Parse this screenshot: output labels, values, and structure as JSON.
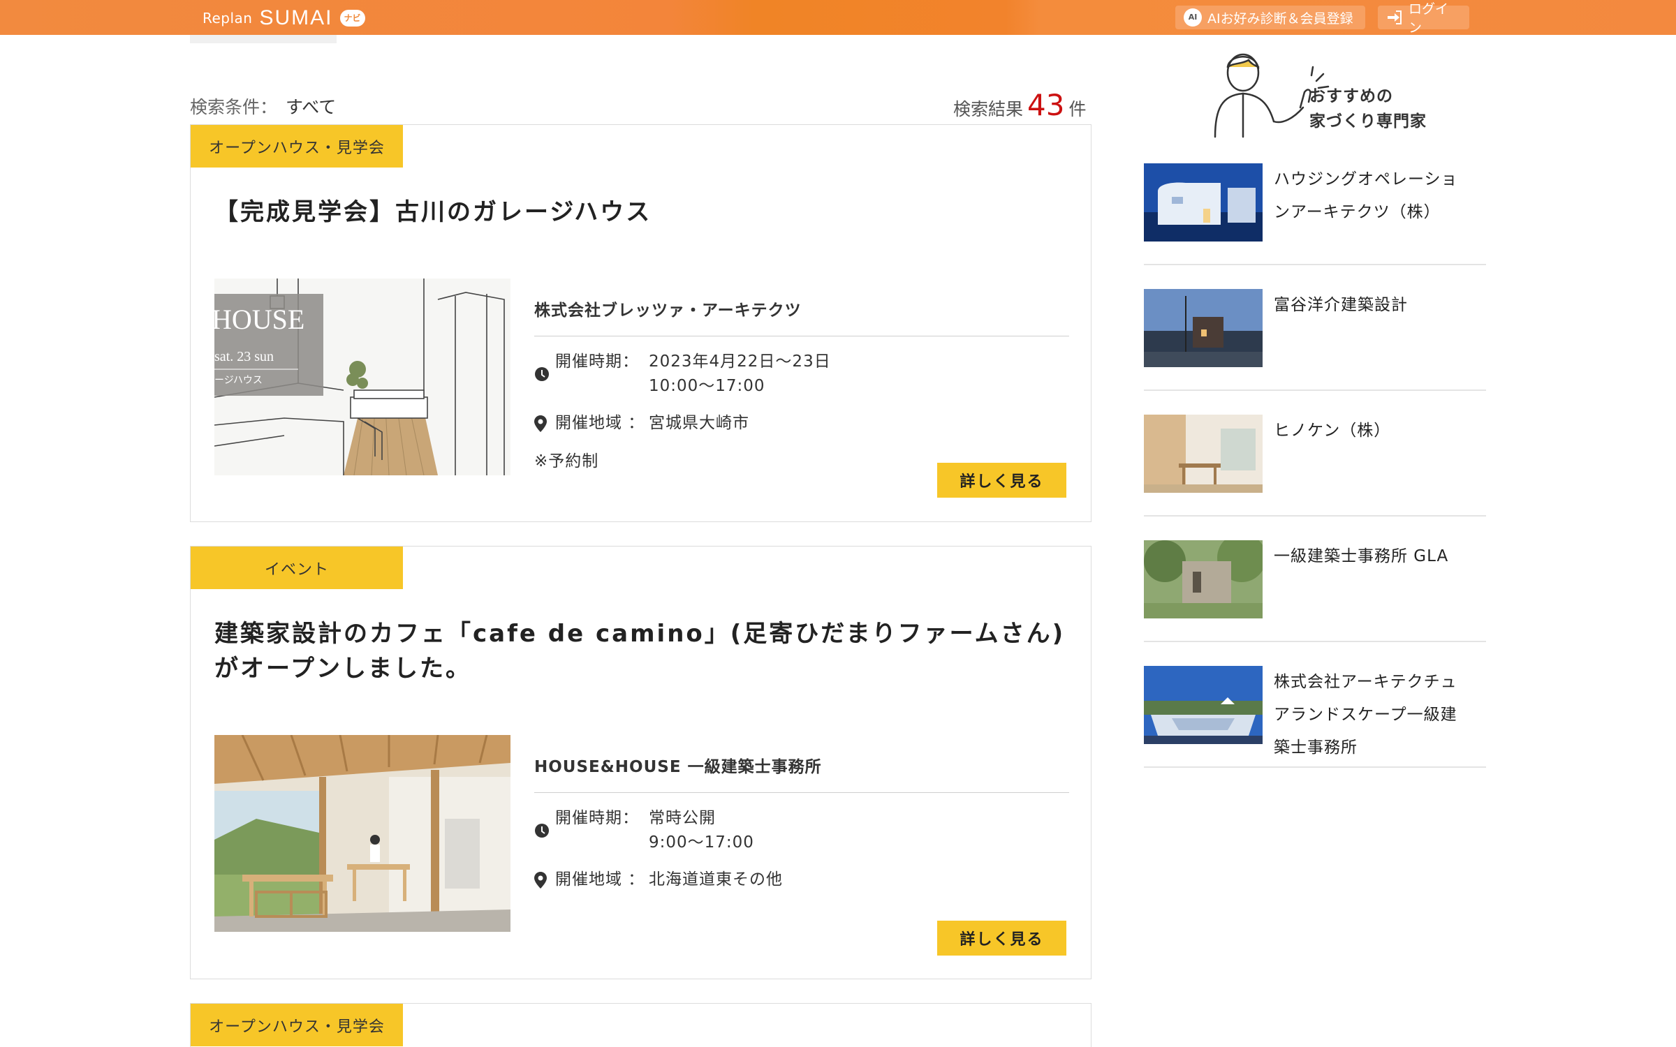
{
  "header": {
    "logo_replan": "Replan",
    "logo_sumai": "SUMAI",
    "logo_navi": "ナビ",
    "ai_button_label": "AIお好み診断＆会員登録",
    "login_label": "ログイン"
  },
  "search": {
    "condition_label": "検索条件：",
    "condition_value": "すべて",
    "result_label": "検索結果",
    "result_count": "43",
    "result_unit": "件"
  },
  "events": [
    {
      "category": "オープンハウス・見学会",
      "title": "【完成見学会】古川のガレージハウス",
      "image_text_big": "HOUSE",
      "image_text_date": "sat. 23 sun",
      "image_text_sub": "ージハウス",
      "company": "株式会社ブレッツァ・アーキテクツ",
      "period_label": "開催時期：",
      "period_date": "2023年4月22日～23日",
      "period_time": "10:00～17:00",
      "area_label": "開催地域 ：",
      "area_value": "宮城県大崎市",
      "note": "※予約制",
      "more_label": "詳しく見る"
    },
    {
      "category": "イベント",
      "title": "建築家設計のカフェ「cafe de camino」(足寄ひだまりファームさん)がオープンしました。",
      "company": "HOUSE&HOUSE 一級建築士事務所",
      "period_label": "開催時期：",
      "period_date": "常時公開",
      "period_time": "9:00～17:00",
      "area_label": "開催地域 ：",
      "area_value": "北海道道東その他",
      "more_label": "詳しく見る"
    },
    {
      "category": "オープンハウス・見学会"
    }
  ],
  "sidebar": {
    "heading_line1": "おすすめの",
    "heading_line2": "家づくり専門家",
    "experts": [
      {
        "name": "ハウジングオペレーションアーキテクツ（株）"
      },
      {
        "name": "富谷洋介建築設計"
      },
      {
        "name": "ヒノケン（株）"
      },
      {
        "name": "一級建築士事務所 GLA"
      },
      {
        "name": "株式会社アーキテクチュアランドスケープ一級建築士事務所"
      }
    ]
  },
  "colors": {
    "header_orange": "#f3853a",
    "tag_yellow": "#f7c628",
    "count_red": "#cc1111"
  }
}
